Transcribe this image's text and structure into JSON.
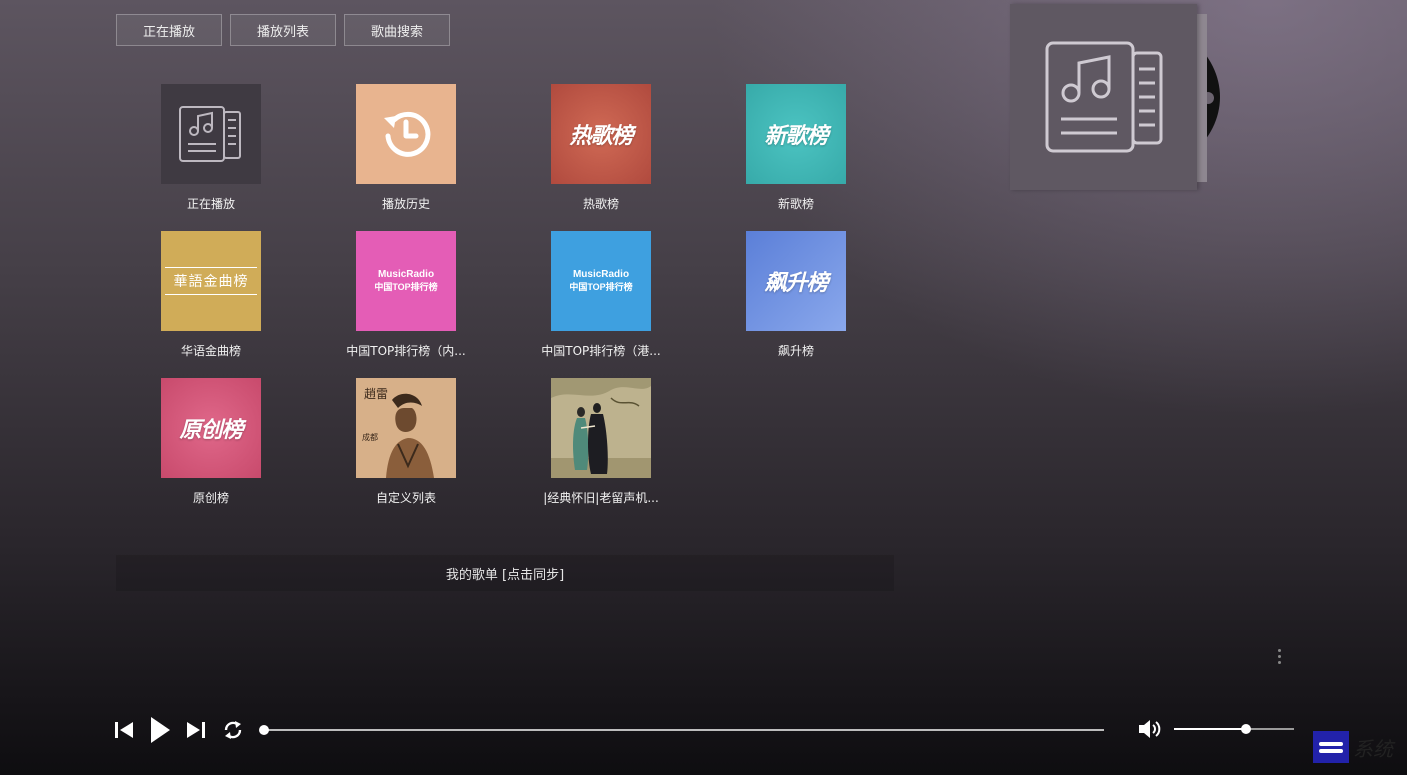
{
  "tabs": [
    {
      "label": "正在播放"
    },
    {
      "label": "播放列表"
    },
    {
      "label": "歌曲搜索"
    }
  ],
  "playlists": [
    {
      "name": "正在播放",
      "cover": "note-list-icon",
      "bg": "#3f3a42"
    },
    {
      "name": "播放历史",
      "cover": "history-clock-icon",
      "bg": "#e8b48f"
    },
    {
      "name": "热歌榜",
      "cover_text": "热歌榜",
      "bg": "#c35a4a"
    },
    {
      "name": "新歌榜",
      "cover_text": "新歌榜",
      "bg": "#3fb8b8"
    },
    {
      "name": "华语金曲榜",
      "cover_text": "華語金曲榜",
      "bg": "#d0ac58"
    },
    {
      "name": "中国TOP排行榜（内...",
      "cover_line1": "MusicRadio",
      "cover_line2": "中国TOP排行榜",
      "bg": "#e45db6"
    },
    {
      "name": "中国TOP排行榜（港...",
      "cover_line1": "MusicRadio",
      "cover_line2": "中国TOP排行榜",
      "bg": "#3ea0e0"
    },
    {
      "name": "飙升榜",
      "cover_text": "飙升榜",
      "bg": "#6f8fe0"
    },
    {
      "name": "原创榜",
      "cover_text": "原创榜",
      "bg": "#d9577a"
    },
    {
      "name": "自定义列表",
      "cover": "singer-photo",
      "bg": "#c79a6e"
    },
    {
      "name": "|经典怀旧|老留声机...",
      "cover": "couple-painting",
      "bg": "#b3aa84"
    }
  ],
  "my_playlists_label": "我的歌单 [点击同步]",
  "player": {
    "progress": 0,
    "volume": 0.6
  },
  "album_art": {
    "icon": "note-list-icon"
  },
  "watermark": {
    "text": "系统"
  }
}
